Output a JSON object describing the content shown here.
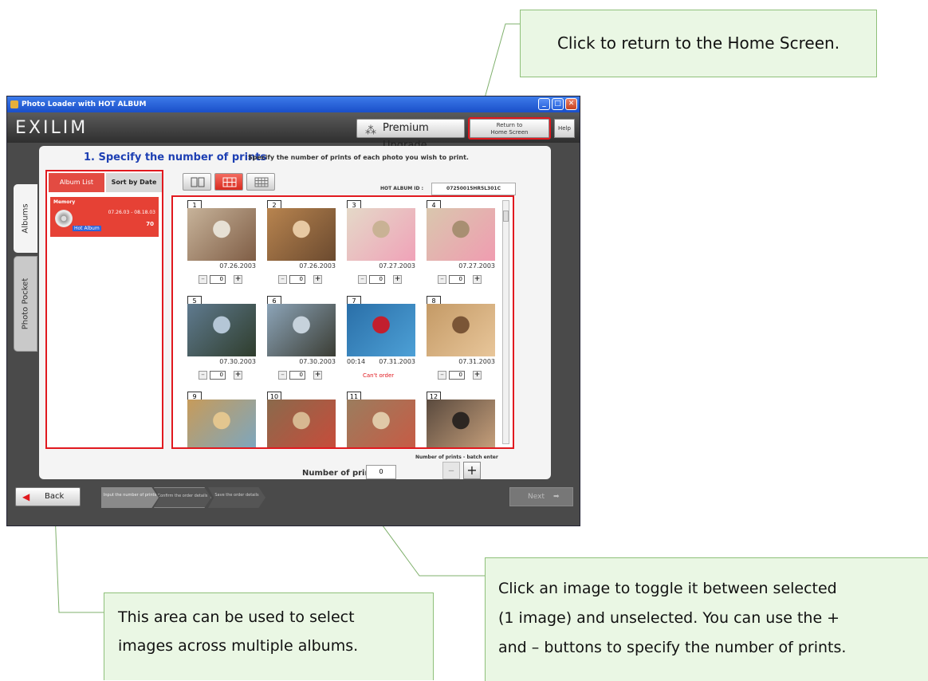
{
  "callouts": {
    "home": "Click to return to the Home Screen.",
    "albums_line1": "This area can be used to select",
    "albums_line2": "images across multiple albums.",
    "grid_line1": "Click an image to toggle it between selected",
    "grid_line2": "(1 image) and unselected. You can use the +",
    "grid_line3": "and – buttons to specify the number of prints."
  },
  "window": {
    "title": "Photo Loader with HOT ALBUM",
    "minimize": "_",
    "maximize": "□",
    "close": "✕"
  },
  "header": {
    "logo": "EXILIM",
    "premium_label": "Premium Upgrade",
    "home_line1": "Return to",
    "home_line2": "Home Screen",
    "help_label": "Help"
  },
  "step": {
    "title": "1. Specify the number of prints",
    "description": "Specify the number of prints of each photo you wish to print."
  },
  "side_tabs": {
    "albums": "Albums",
    "photo_pocket": "Photo Pocket"
  },
  "album_panel": {
    "tab_album_list": "Album List",
    "tab_sort_by_date": "Sort by Date",
    "album": {
      "name": "Memory",
      "dates": "07.26.03 - 08.18.03",
      "count": "70",
      "tag": "Hot Album"
    }
  },
  "hot_album_id": {
    "label": "HOT ALBUM ID :",
    "value": "07250015HR5L301C"
  },
  "photos": [
    {
      "num": "1",
      "date": "07.26.2003",
      "count": "0",
      "colors": [
        "#c7b39a",
        "#7f5d45",
        "#e6e0d4"
      ]
    },
    {
      "num": "2",
      "date": "07.26.2003",
      "count": "0",
      "colors": [
        "#b8844f",
        "#6b4a2f",
        "#e7c9a3"
      ]
    },
    {
      "num": "3",
      "date": "07.27.2003",
      "count": "0",
      "colors": [
        "#e4d9c8",
        "#f0a2b8",
        "#c9b295"
      ]
    },
    {
      "num": "4",
      "date": "07.27.2003",
      "count": "0",
      "colors": [
        "#d9c7ae",
        "#f09cb0",
        "#a88f72"
      ]
    },
    {
      "num": "5",
      "date": "07.30.2003",
      "count": "0",
      "colors": [
        "#5f7a8f",
        "#2f3d2c",
        "#b4c6d6"
      ]
    },
    {
      "num": "6",
      "date": "07.30.2003",
      "count": "0",
      "colors": [
        "#8ca4b8",
        "#3b3d34",
        "#c6d2dc"
      ]
    },
    {
      "num": "7",
      "date": "07.31.2003",
      "duration": "00:14",
      "cant_order": "Can't order",
      "colors": [
        "#2a6fa8",
        "#4da0d6",
        "#c21f2e"
      ]
    },
    {
      "num": "8",
      "date": "07.31.2003",
      "count": "0",
      "colors": [
        "#c49a66",
        "#e8c69a",
        "#7a5536"
      ]
    },
    {
      "num": "9",
      "colors": [
        "#c79b5a",
        "#7aa7c2",
        "#e3c68f"
      ]
    },
    {
      "num": "10",
      "colors": [
        "#8a6a4c",
        "#c94b3a",
        "#d7b891"
      ]
    },
    {
      "num": "11",
      "colors": [
        "#9b7d5e",
        "#c85a44",
        "#e0c9a8"
      ]
    },
    {
      "num": "12",
      "colors": [
        "#5a4a3e",
        "#c9a27d",
        "#2c2622"
      ]
    }
  ],
  "batch": {
    "label": "Number of prints - batch enter",
    "number_label": "Number of prints :",
    "number_value": "0",
    "minus": "–",
    "plus": "+"
  },
  "footer": {
    "back_label": "Back",
    "crumb1": "Input the number of prints",
    "crumb2": "Confirm the order details",
    "crumb3": "Save the order details",
    "next_label": "Next"
  },
  "colors": {
    "highlight": "#e1191f",
    "callout_bg": "#eaf7e4",
    "callout_border": "#8fc07a",
    "step_title": "#1d3fb3"
  }
}
